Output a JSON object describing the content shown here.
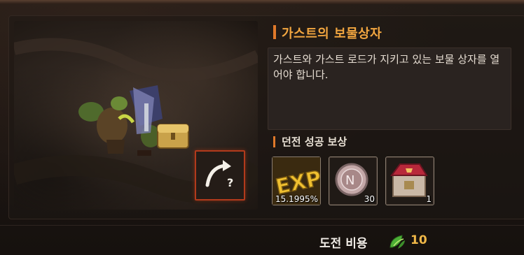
{
  "dungeon": {
    "title": "가스트의 보물상자",
    "description": "가스트와 가스트 로드가 지키고 있는 보물 상자를 열어야 합니다."
  },
  "rewards": {
    "title": "던전 성공 보상",
    "items": [
      {
        "icon": "exp-icon",
        "label": "15.1995%"
      },
      {
        "icon": "silver-coin-icon",
        "label": "30"
      },
      {
        "icon": "treasure-chest-icon",
        "label": "1"
      }
    ]
  },
  "cost": {
    "label": "도전 비용",
    "icon": "leaf-icon",
    "value": "10"
  },
  "colors": {
    "accent": "#e0792a",
    "title": "#f2a640",
    "cost_value": "#f0b848"
  }
}
